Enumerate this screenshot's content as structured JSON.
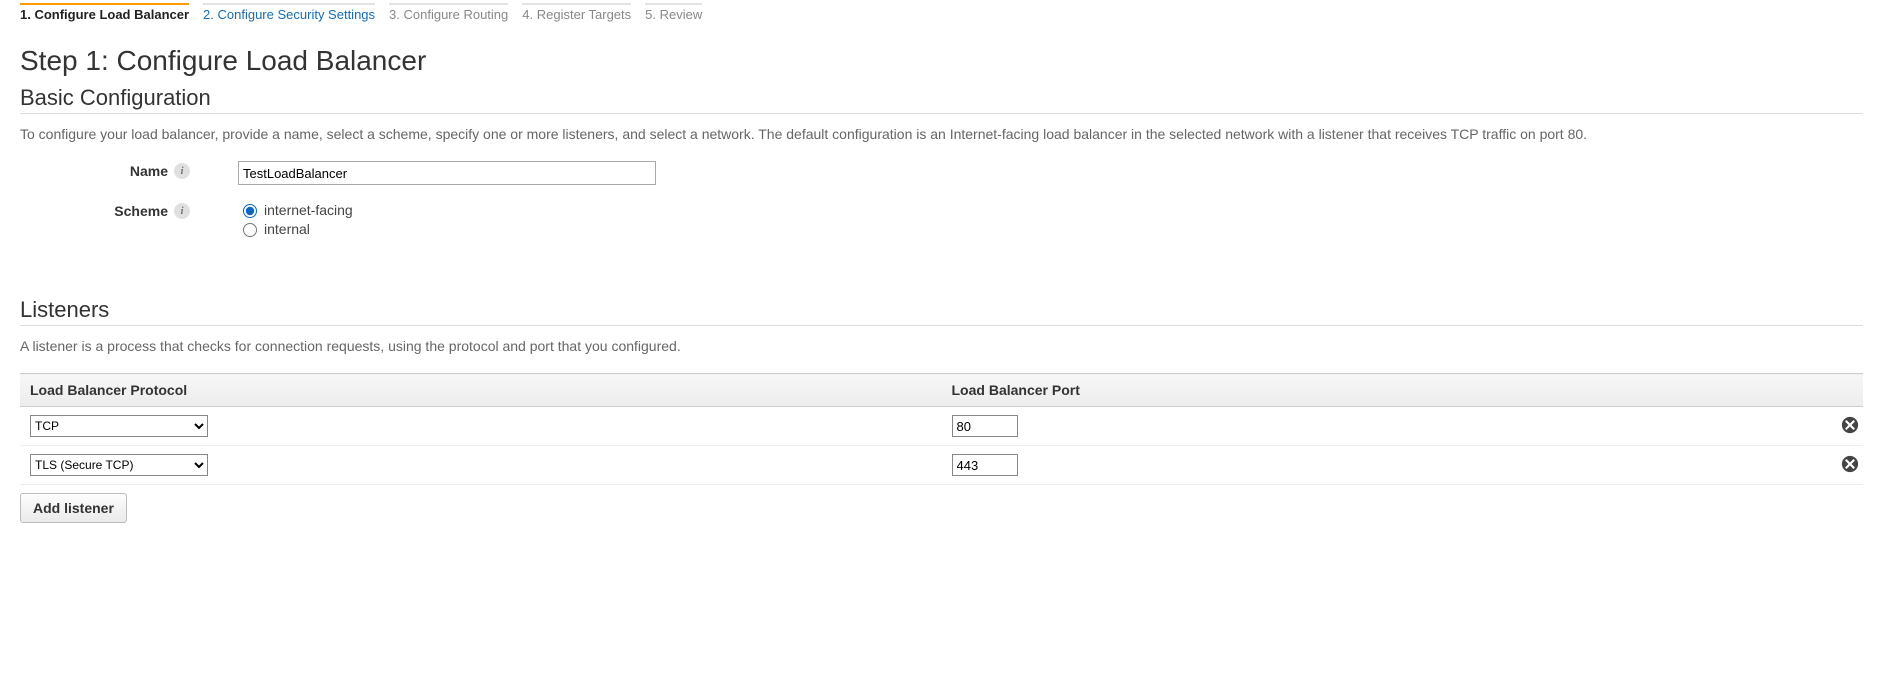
{
  "wizard": {
    "steps": [
      {
        "label": "1. Configure Load Balancer",
        "state": "active"
      },
      {
        "label": "2. Configure Security Settings",
        "state": "link"
      },
      {
        "label": "3. Configure Routing",
        "state": "disabled"
      },
      {
        "label": "4. Register Targets",
        "state": "disabled"
      },
      {
        "label": "5. Review",
        "state": "disabled"
      }
    ]
  },
  "page": {
    "title": "Step 1: Configure Load Balancer"
  },
  "basic": {
    "heading": "Basic Configuration",
    "description": "To configure your load balancer, provide a name, select a scheme, specify one or more listeners, and select a network. The default configuration is an Internet-facing load balancer in the selected network with a listener that receives TCP traffic on port 80.",
    "name_label": "Name",
    "name_value": "TestLoadBalancer",
    "scheme_label": "Scheme",
    "scheme_options": {
      "internet_facing": "internet-facing",
      "internal": "internal"
    },
    "scheme_selected": "internet_facing"
  },
  "listeners": {
    "heading": "Listeners",
    "description": "A listener is a process that checks for connection requests, using the protocol and port that you configured.",
    "columns": {
      "protocol": "Load Balancer Protocol",
      "port": "Load Balancer Port"
    },
    "rows": [
      {
        "protocol": "TCP",
        "port": "80"
      },
      {
        "protocol": "TLS (Secure TCP)",
        "port": "443"
      }
    ],
    "add_button": "Add listener"
  }
}
